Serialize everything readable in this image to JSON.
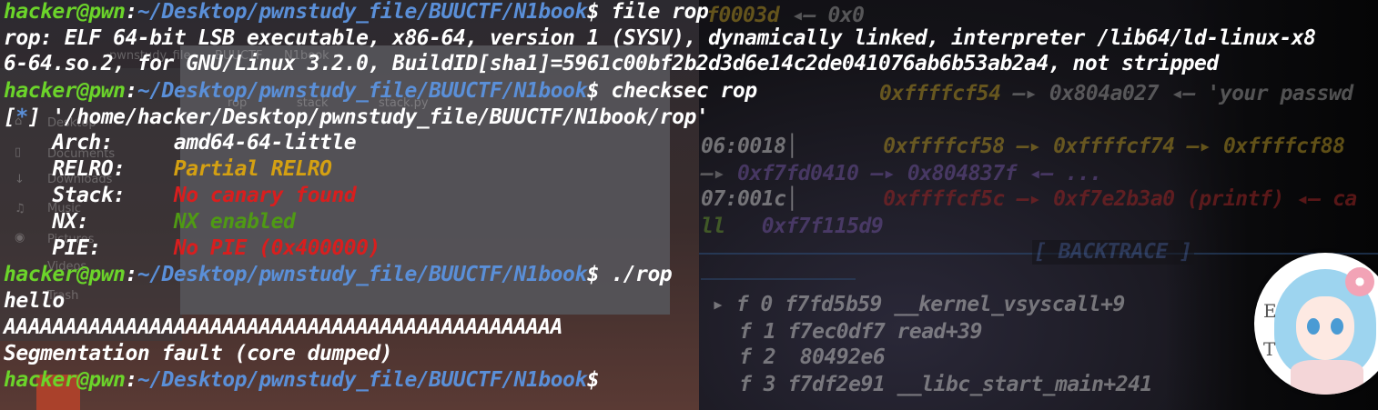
{
  "terminal": {
    "prompt": {
      "user_host": "hacker@pwn",
      "separator": ":",
      "path": "~/Desktop/pwnstudy_file/BUUCTF/N1book",
      "symbol": "$"
    },
    "cmd_file": " file rop",
    "file_output_line1": "rop: ELF 64-bit LSB executable, x86-64, version 1 (SYSV), dynamically linked, interpreter /lib64/ld-linux-x8",
    "file_output_line2": "6-64.so.2, for GNU/Linux 3.2.0, BuildID[sha1]=5961c00bf2b2d3d6e14c2de041076ab6b53ab2a4, not stripped",
    "cmd_checksec": " checksec rop",
    "checksec_marker_open": "[",
    "checksec_marker_star": "*",
    "checksec_marker_close": "]",
    "checksec_path": " '/home/hacker/Desktop/pwnstudy_file/BUUCTF/N1book/rop'",
    "checksec_rows": [
      {
        "label": "    Arch:     ",
        "value": "amd64-64-little"
      },
      {
        "label": "    RELRO:    ",
        "value": "Partial RELRO"
      },
      {
        "label": "    Stack:    ",
        "value": "No canary found"
      },
      {
        "label": "    NX:       ",
        "value": "NX enabled"
      },
      {
        "label": "    PIE:      ",
        "value": "No PIE (0x400000)"
      }
    ],
    "cmd_run": " ./rop",
    "run_output": [
      "hello",
      "AAAAAAAAAAAAAAAAAAAAAAAAAAAAAAAAAAAAAAAAAAAAAA",
      "Segmentation fault (core dumped)"
    ],
    "status_colors": {
      "yellow": "#d4a012",
      "red": "#d91e1e",
      "green": "#4f9a14"
    }
  },
  "gdb_background": {
    "lines": [
      {
        "a": "f0003d ",
        "b": "◂— 0x0"
      },
      {
        "a": "0xffffcf54 ",
        "b": "—▸ 0x804a027 ◂— 'your passwd"
      },
      {
        "a": "06:0018│       ",
        "b": "0xffffcf58 —▸ 0xffffcf74 —▸ 0xffffcf88"
      },
      {
        "a": "—▸ ",
        "b": "0xf7fd0410 —▸ 0x804837f ◂— ..."
      },
      {
        "a": "07:001c│       ",
        "b": "0xffffcf5c —▸ 0xf7e2b3a0 (printf) ◂— ca"
      },
      {
        "a": "ll   ",
        "b": "0xf7f115d9"
      }
    ],
    "backtrace_title": "[ BACKTRACE ]",
    "frames": [
      {
        "marker": "▸",
        "text": "f 0 f7fd5b59 __kernel_vsyscall+9"
      },
      {
        "marker": "",
        "text": "f 1 f7ec0df7 read+39"
      },
      {
        "marker": "",
        "text": "f 2  80492e6"
      },
      {
        "marker": "",
        "text": "f 3 f7df2e91 __libc_start_main+241"
      }
    ]
  },
  "file_manager_ghost": {
    "sidebar": [
      "Desktop",
      "Documents",
      "Downloads",
      "Music",
      "Pictures",
      "Videos",
      "Trash"
    ],
    "tabs": [
      "pwnstudy_file",
      "BUUCTF",
      "N1book"
    ],
    "files": [
      "rop",
      "stack",
      "stack.py"
    ]
  },
  "avatar": {
    "letters": [
      "E",
      "T"
    ]
  }
}
